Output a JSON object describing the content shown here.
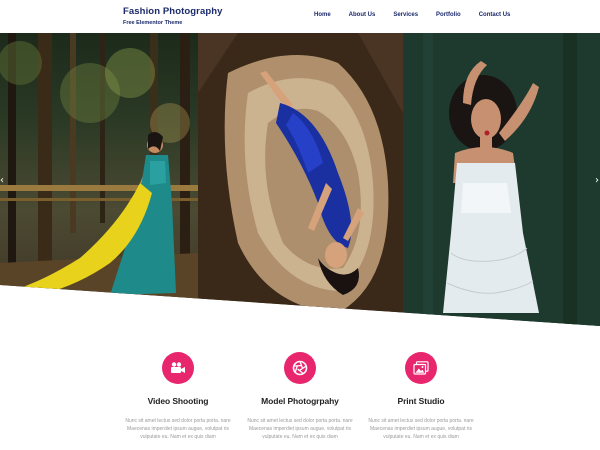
{
  "site": {
    "title": "Fashion Photography",
    "tagline": "Free Elementor Theme"
  },
  "nav": {
    "items": [
      {
        "label": "Home"
      },
      {
        "label": "About Us"
      },
      {
        "label": "Services"
      },
      {
        "label": "Portfolio"
      },
      {
        "label": "Contact Us"
      }
    ]
  },
  "hero": {
    "prev_icon": "chevron-left-icon",
    "next_icon": "chevron-right-icon",
    "prev_glyph": "‹",
    "next_glyph": "›",
    "slides": [
      {
        "description_icon": "photo-woman-teal-gown"
      },
      {
        "description_icon": "photo-woman-blue-dress-on-fur"
      },
      {
        "description_icon": "photo-woman-white-dress"
      }
    ]
  },
  "features": [
    {
      "icon": "video-camera-icon",
      "title": "Video Shooting",
      "text": "Nunc sit amet lectus sed dolor porta porta. nare Maecenas imperdiet ipsum augue, volutpat ris vulputate eu. Nam et ex quis diam"
    },
    {
      "icon": "camera-aperture-icon",
      "title": "Model Photogrpahy",
      "text": "Nunc sit amet lectus sed dolor porta porta. nare Maecenas imperdiet ipsum augue, volutpat ris vulputate eu. Nam et ex quis diam"
    },
    {
      "icon": "image-gallery-icon",
      "title": "Print Studio",
      "text": "Nunc sit amet lectus sed dolor porta porta. nare Maecenas imperdiet ipsum augue, volutpat ris vulputate eu. Nam et ex quis diam"
    }
  ],
  "colors": {
    "brand_navy": "#1b2a6b",
    "accent_pink": "#e8266e",
    "body_gray": "#9a9a9a"
  }
}
